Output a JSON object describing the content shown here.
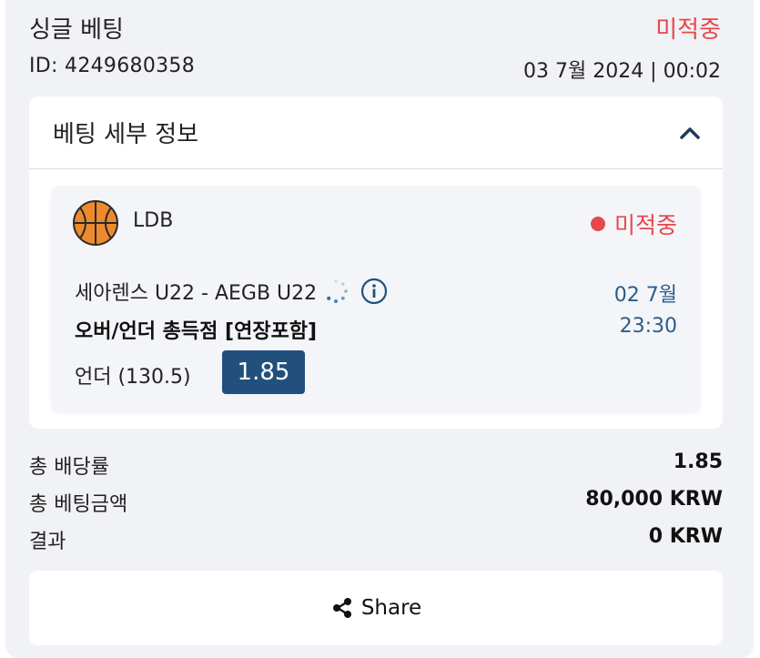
{
  "header": {
    "title": "싱글 베팅",
    "status": "미적중",
    "bet_id": "ID: 4249680358",
    "datetime": "03 7월 2024 | 00:02"
  },
  "details": {
    "title": "베팅 세부 정보",
    "toggle_icon": "chevron-up-icon",
    "event": {
      "sport_icon": "basketball-icon",
      "league": "LDB",
      "status": "미적중",
      "match": "세아렌스 U22 - AEGB U22",
      "market": "오버/언더 총득점 [연장포함]",
      "selection": "언더 (130.5)",
      "odds": "1.85",
      "date": "02 7월",
      "time": "23:30"
    }
  },
  "summary": {
    "total_odds_label": "총 배당률",
    "total_odds_value": "1.85",
    "total_stake_label": "총 베팅금액",
    "total_stake_value": "80,000 KRW",
    "result_label": "결과",
    "result_value": "0 KRW"
  },
  "share": {
    "label": "Share",
    "icon": "share-icon"
  },
  "colors": {
    "loss_red": "#e5484d",
    "odds_blue": "#22507d",
    "date_blue": "#2c5c8a",
    "background": "#f1f2f5"
  }
}
